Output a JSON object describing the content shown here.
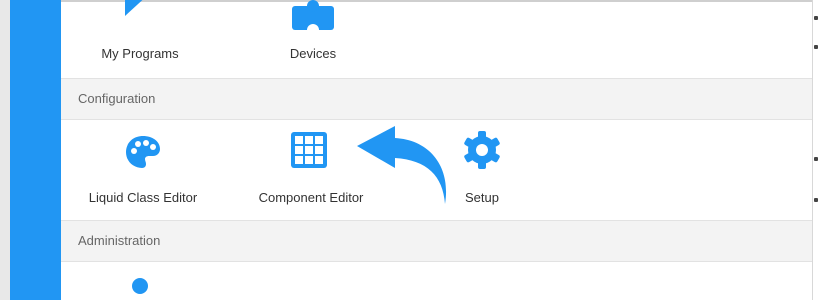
{
  "sections": {
    "configuration": {
      "label": "Configuration"
    },
    "administration": {
      "label": "Administration"
    }
  },
  "tiles": {
    "my_programs": {
      "label": "My Programs",
      "icon": "play-icon"
    },
    "devices": {
      "label": "Devices",
      "icon": "puzzle-icon"
    },
    "liquid_class_editor": {
      "label": "Liquid Class Editor",
      "icon": "palette-icon"
    },
    "component_editor": {
      "label": "Component Editor",
      "icon": "grid-icon"
    },
    "setup": {
      "label": "Setup",
      "icon": "gear-icon"
    },
    "admin_item": {
      "label": "",
      "icon": "user-icon"
    }
  },
  "annotation": {
    "icon": "curved-arrow-icon"
  },
  "colors": {
    "accent": "#2196f3",
    "section_bg": "#f3f3f3",
    "label_text": "#333333",
    "section_text": "#666666"
  }
}
